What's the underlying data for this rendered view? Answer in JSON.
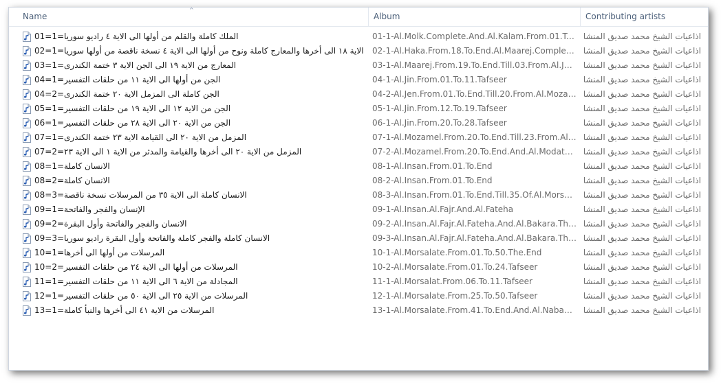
{
  "columns": {
    "name": "Name",
    "album": "Album",
    "artist": "Contributing artists"
  },
  "icon": "audio-file-icon",
  "rows": [
    {
      "name": "الملك كاملة والقلم من أولها الى الاية ٤ راديو سوريا=1=01",
      "album": "01-1-Al.Molk.Complete.And.Al.Kalam.From.01.To.04....",
      "artist": "اذاعيات الشيخ محمد صديق المنشاوى"
    },
    {
      "name": "الحاقة من الاية ١٨ الى أخرها والمعارج كاملة ونوح من أولها الى الاية ٤ نسخة ناقصة من أولها سوريا=1=02",
      "album": "02-1-Al.Haka.From.18.To.End.Al.Maarej.Complete.No...",
      "artist": "اذاعيات الشيخ محمد صديق المنشاوى"
    },
    {
      "name": "المعارج من الاية ١٩ الى الجن الاية ٣ ختمة الكندرى=1=03",
      "album": "03-1-Al.Maarej.From.19.To.End.Till.03.From.Al.Jen.Kan...",
      "artist": "اذاعيات الشيخ محمد صديق المنشاوى"
    },
    {
      "name": "الجن من أولها الى الاية ١١ من حلقات التفسير=1=04",
      "album": "04-1-Al.Jin.From.01.To.11.Tafseer",
      "artist": "اذاعيات الشيخ محمد صديق المنشاوى"
    },
    {
      "name": "الجن كاملة الى المزمل الاية ٢٠ ختمة الكندرى=2=04",
      "album": "04-2-Al.Jen.From.01.To.End.Till.20.From.Al.Mozamel.K...",
      "artist": "اذاعيات الشيخ محمد صديق المنشاوى"
    },
    {
      "name": "الجن من الاية ١٢ الى الاية ١٩ من حلقات التفسير=1=05",
      "album": "05-1-Al.Jin.From.12.To.19.Tafseer",
      "artist": "اذاعيات الشيخ محمد صديق المنشاوى"
    },
    {
      "name": "الجن من الاية ٢٠ الى الاية ٢٨ من حلقات التفسير=1=06",
      "album": "06-1-Al.Jin.From.20.To.28.Tafseer",
      "artist": "اذاعيات الشيخ محمد صديق المنشاوى"
    },
    {
      "name": "المزمل من الاية ٢٠ الى القيامة الاية ٢٣ ختمة الكندرى=1=07",
      "album": "07-1-Al.Mozamel.From.20.To.End.Till.23.From.Al.Kea...",
      "artist": "اذاعيات الشيخ محمد صديق المنشاوى"
    },
    {
      "name": "المزمل من الاية ٢٠ الى أخرها والقيامة والمدثر من الاية ١ الى الاية ٢٣=2=07",
      "album": "07-2-Al.Mozamel.From.20.To.End.And.Al.Modather.A...",
      "artist": "اذاعيات الشيخ محمد صديق المنشاوى"
    },
    {
      "name": "الانسان كاملة=1=08",
      "album": "08-1-Al.Insan.From.01.To.End",
      "artist": "اذاعيات الشيخ محمد صديق المنشاوى"
    },
    {
      "name": "الانسان كاملة=2=08",
      "album": "08-2-Al.Insan.From.01.To.End",
      "artist": "اذاعيات الشيخ محمد صديق المنشاوى"
    },
    {
      "name": "الانسان كاملة الى الاية ٣٥ من المرسلات نسخة ناقصة=3=08",
      "album": "08-3-Al.Insan.From.01.To.End.Till.35.Of.Al.Morsalate....",
      "artist": "اذاعيات الشيخ محمد صديق المنشاوى"
    },
    {
      "name": "الإنسان والفجر والفاتحة=1=09",
      "album": "09-1-Al.Insan.Al.Fajr.And.Al.Fateha",
      "artist": "اذاعيات الشيخ محمد صديق المنشاوى"
    },
    {
      "name": "الانسان والفجر والفاتحة وأول البقرة=2=09",
      "album": "09-2-Al.Insan.Al.Fajr.Al.Fateha.And.Al.Bakara.The.Start",
      "artist": "اذاعيات الشيخ محمد صديق المنشاوى"
    },
    {
      "name": "الانسان كاملة والفجر كاملة والفاتحة وأول البقرة راديو سوريا=3=09",
      "album": "09-3-Al.Insan.Al.Fajr.Al.Fateha.And.Al.Bakara.The.Start...",
      "artist": "اذاعيات الشيخ محمد صديق المنشاوى"
    },
    {
      "name": "المرسلات من أولها الى أخرها=1=10",
      "album": "10-1-Al.Morsalate.From.01.To.50.The.End",
      "artist": "اذاعيات الشيخ محمد صديق المنشاوى"
    },
    {
      "name": "المرسلات من أولها الى الاية ٢٤ من حلقات التفسير=2=10",
      "album": "10-2-Al.Morsalate.From.01.To.24.Tafseer",
      "artist": "اذاعيات الشيخ محمد صديق المنشاوى"
    },
    {
      "name": "المجادلة من الاية ٦ الى الاية ١١ من حلقات التفسير=1=11",
      "album": "11-1-Al.Morsalat.From.06.To.11.Tafseer",
      "artist": "اذاعيات الشيخ محمد صديق المنشاوى"
    },
    {
      "name": "المرسلات من الاية ٢٥ الى الاية ٥٠ من حلقات التفسير=1=12",
      "album": "12-1-Al.Morsalate.From.25.To.50.Tafseer",
      "artist": "اذاعيات الشيخ محمد صديق المنشاوى"
    },
    {
      "name": "المرسلات من الاية ٤١ الى أخرها والنبأ كاملة=1=13",
      "album": "13-1-Al.Morsalate.From.41.To.End.And.Al.Nabae.Com...",
      "artist": "اذاعيات الشيخ محمد صديق المنشاوى"
    }
  ]
}
